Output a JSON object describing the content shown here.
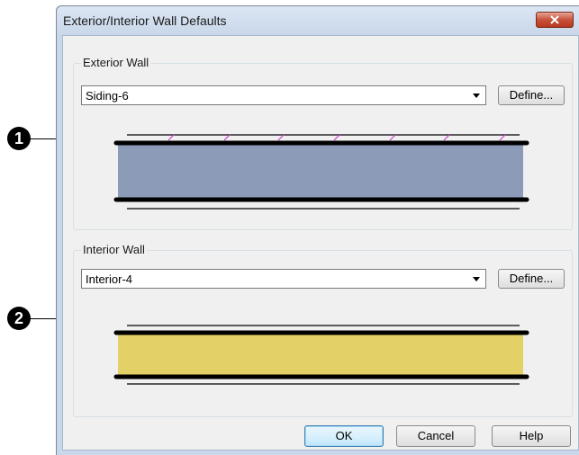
{
  "dialog": {
    "title": "Exterior/Interior Wall Defaults"
  },
  "exterior": {
    "group_label": "Exterior Wall",
    "selected": "Siding-6",
    "define_label": "Define..."
  },
  "interior": {
    "group_label": "Interior Wall",
    "selected": "Interior-4",
    "define_label": "Define..."
  },
  "buttons": {
    "ok": "OK",
    "cancel": "Cancel",
    "help": "Help"
  },
  "callouts": {
    "one": "1",
    "two": "2"
  },
  "colors": {
    "exterior_fill": "#8c9bb7",
    "interior_fill": "#e3d066",
    "siding_hatch": "#d63cd6"
  }
}
